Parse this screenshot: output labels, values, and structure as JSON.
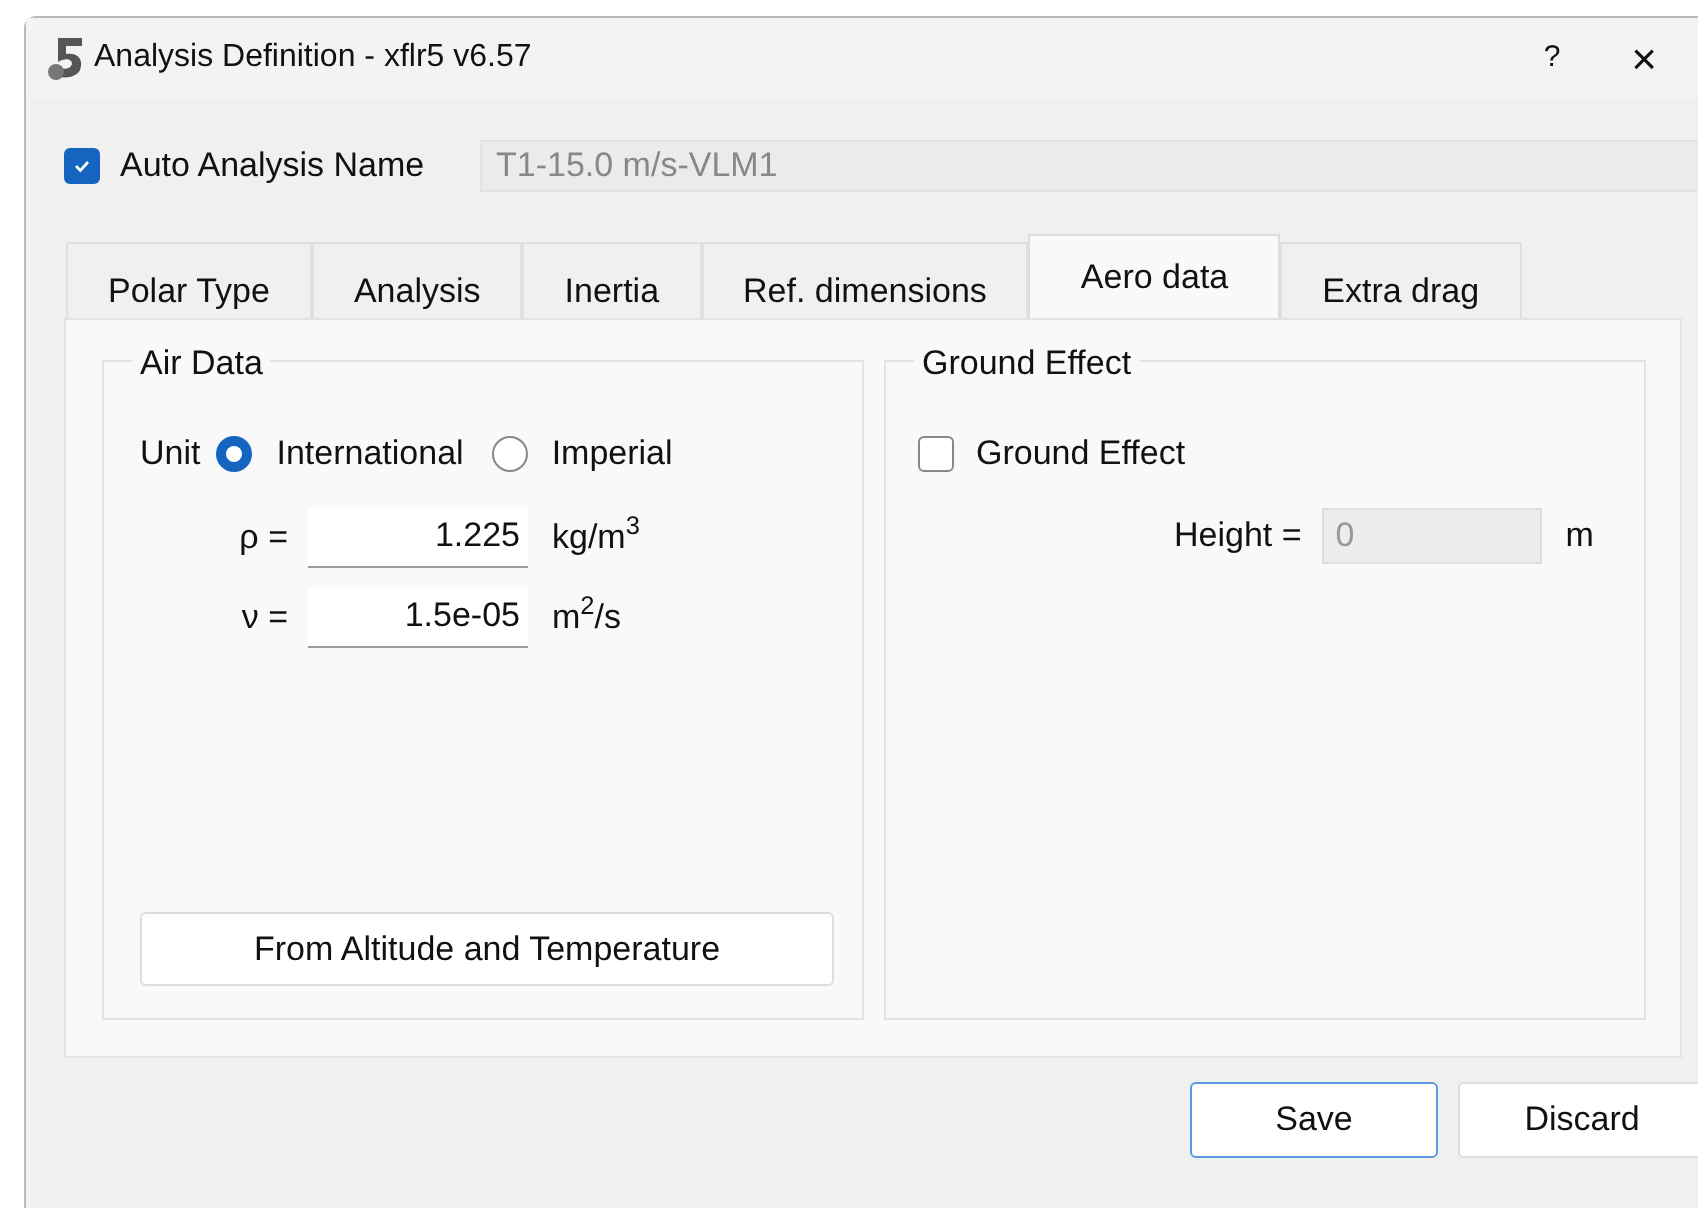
{
  "window": {
    "title": "Analysis Definition - xflr5 v6.57",
    "help": "?",
    "close": "×"
  },
  "auto_name": {
    "label": "Auto Analysis Name",
    "checked": true,
    "value": "T1-15.0 m/s-VLM1"
  },
  "tabs": [
    {
      "label": "Polar Type",
      "selected": false
    },
    {
      "label": "Analysis",
      "selected": false
    },
    {
      "label": "Inertia",
      "selected": false
    },
    {
      "label": "Ref. dimensions",
      "selected": false
    },
    {
      "label": "Aero data",
      "selected": true
    },
    {
      "label": "Extra drag",
      "selected": false
    }
  ],
  "air_data": {
    "title": "Air Data",
    "unit_label": "Unit",
    "units": [
      {
        "label": "International",
        "selected": true
      },
      {
        "label": "Imperial",
        "selected": false
      }
    ],
    "fields": [
      {
        "label": "ρ =",
        "value": "1.225",
        "unit": "kg/m$^{3}$"
      },
      {
        "label": "ν =",
        "value": "1.5e-05",
        "unit": "m$^{2}$/s"
      }
    ],
    "button": "From Altitude and Temperature"
  },
  "ground_effect": {
    "title": "Ground Effect",
    "checkbox": {
      "label": "Ground Effect",
      "checked": false
    },
    "height_label": "Height =",
    "height_value": "0",
    "height_unit": "m"
  },
  "buttons": [
    {
      "label": "Save",
      "default": true
    },
    {
      "label": "Discard",
      "default": false
    }
  ]
}
